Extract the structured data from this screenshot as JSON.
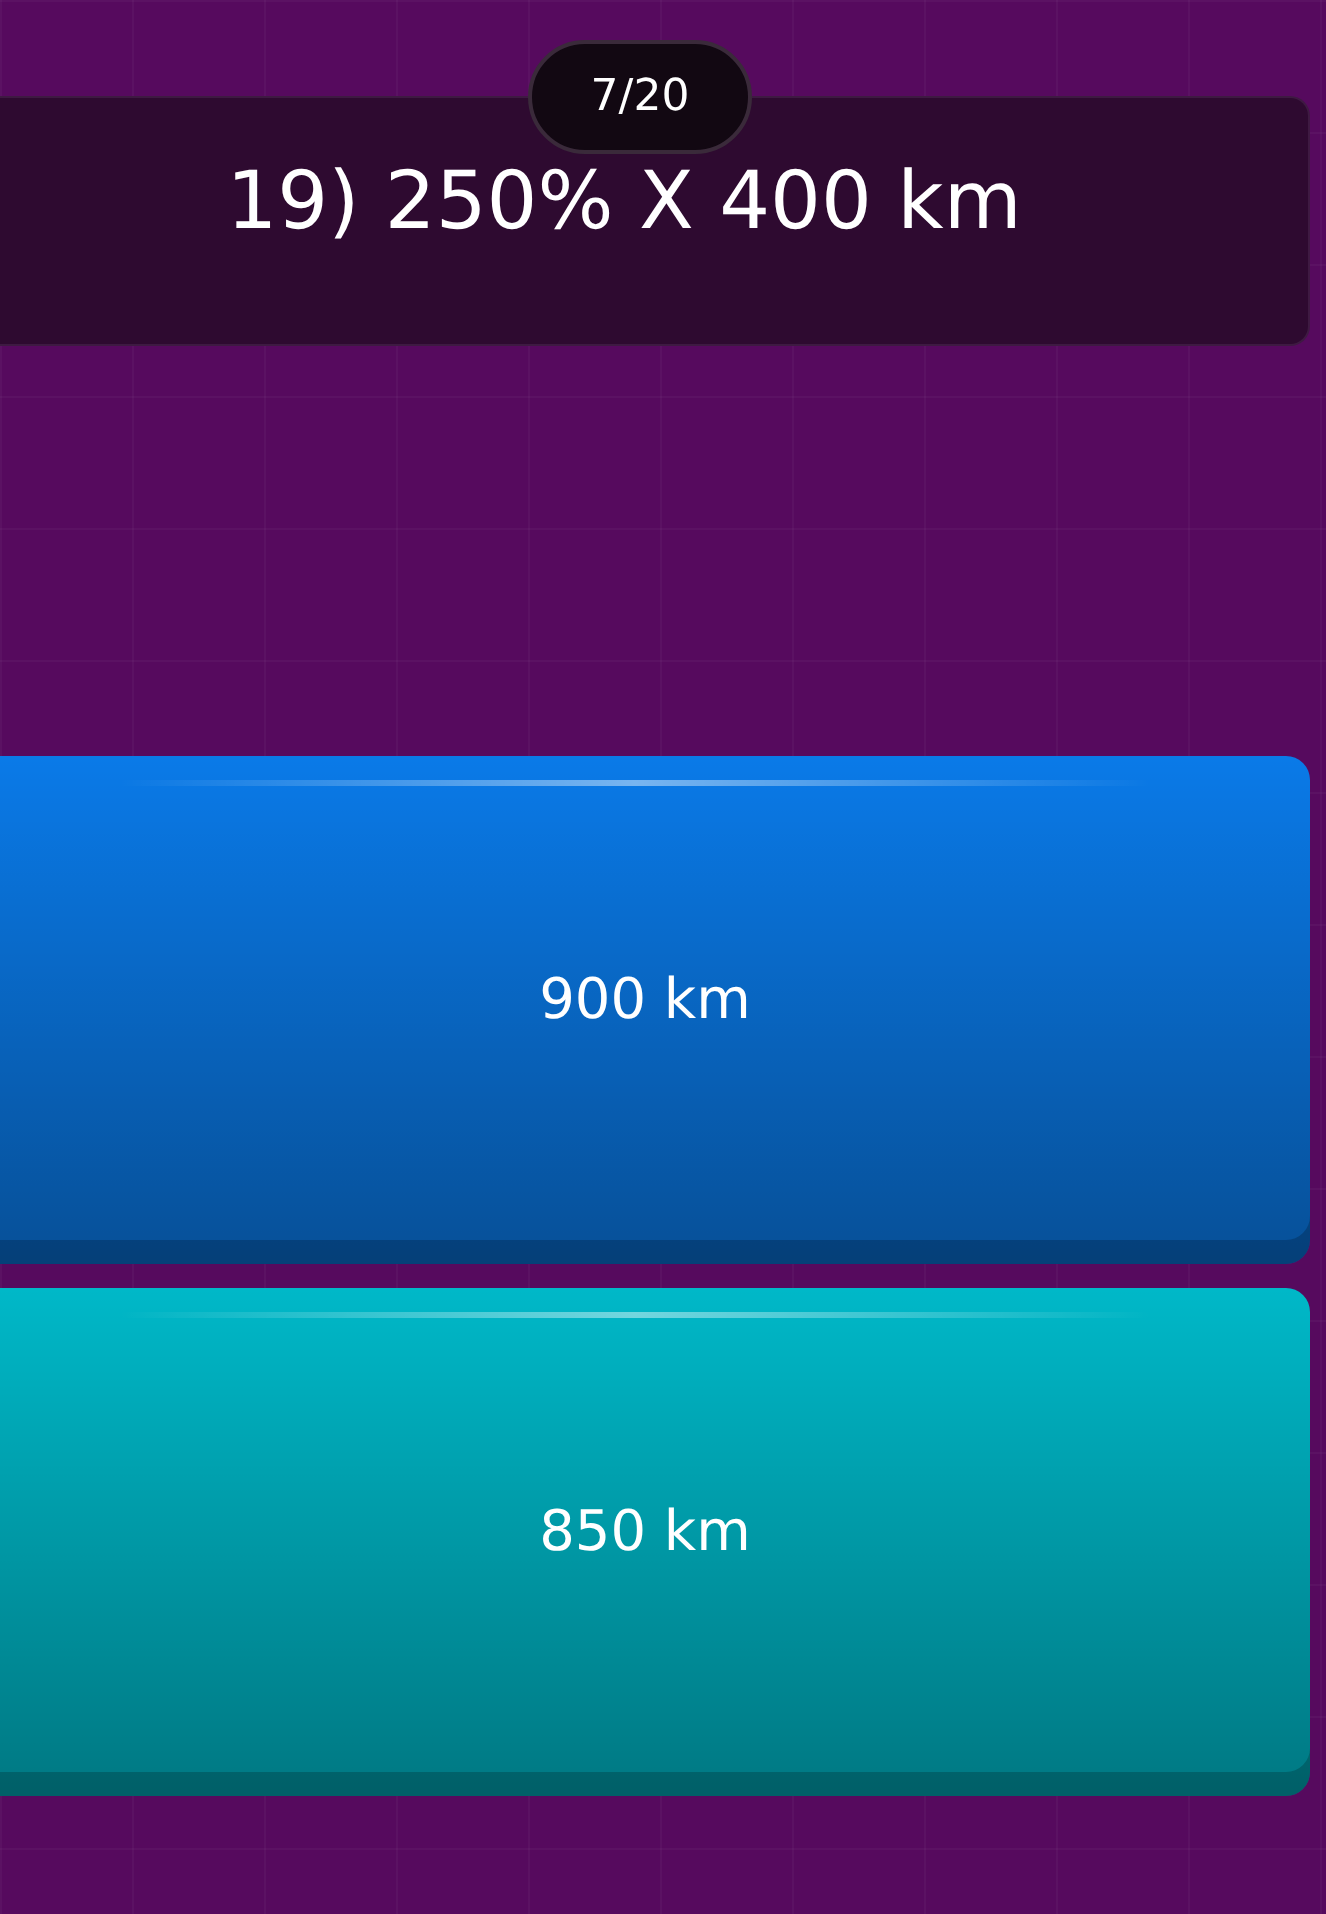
{
  "counter": "7/20",
  "question": "19) 250% X 400 km",
  "answers": [
    {
      "label": "900 km",
      "color": "#0a7ae8"
    },
    {
      "label": "850 km",
      "color": "#00b8c8"
    }
  ]
}
